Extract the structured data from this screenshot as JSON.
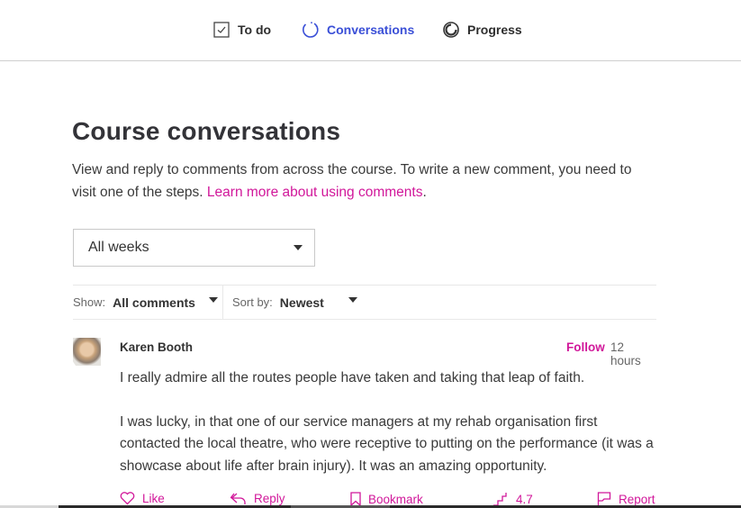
{
  "nav": {
    "items": [
      {
        "label": "To do",
        "icon": "checkbox-icon",
        "active": false
      },
      {
        "label": "Conversations",
        "icon": "spinner-circle-icon",
        "active": true
      },
      {
        "label": "Progress",
        "icon": "progress-circle-icon",
        "active": false
      }
    ]
  },
  "page": {
    "title": "Course conversations",
    "intro_text": "View and reply to comments from across the course. To write a new comment, you need to visit one of the steps.",
    "intro_link": "Learn more about using comments",
    "intro_suffix": "."
  },
  "filters": {
    "week_select_value": "All weeks",
    "show_label": "Show:",
    "show_value": "All comments",
    "sort_label": "Sort by:",
    "sort_value": "Newest"
  },
  "comments": [
    {
      "author": "Karen Booth",
      "follow_label": "Follow",
      "time": "12 hours",
      "paragraphs": [
        "I really admire all the routes people have taken and taking that leap of faith.",
        "I was lucky, in that one of our service managers at my rehab organisation first contacted the local theatre, who were receptive to putting on the performance (it was a showcase about life after brain injury). It was an amazing opportunity."
      ],
      "actions": {
        "like": "Like",
        "reply": "Reply",
        "bookmark": "Bookmark",
        "rating": "4.7",
        "report": "Report"
      }
    }
  ],
  "colors": {
    "accent_pink": "#d1179a",
    "active_nav_blue": "#3a4fd7",
    "text": "#333333"
  }
}
